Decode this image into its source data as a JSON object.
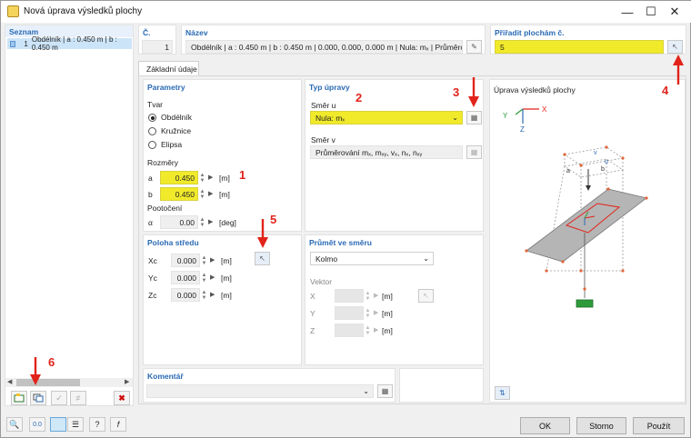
{
  "window": {
    "title": "Nová úprava výsledků plochy"
  },
  "list": {
    "header": "Seznam",
    "items": [
      {
        "number": "1",
        "text": "Obdélník | a : 0.450 m | b : 0.450 m"
      }
    ]
  },
  "header": {
    "number_label": "Č.",
    "number_value": "1",
    "name_label": "Název",
    "name_value": "Obdélník | a : 0.450 m | b : 0.450 m | 0.000, 0.000, 0.000 m | Nula: mₓ | Průměrování mₓ, mᵧ, vₓ, nₓ, nₓᵧ",
    "assign_label": "Přiřadit plochám č.",
    "assign_value": "5"
  },
  "tabs": [
    "Základní údaje"
  ],
  "parameters": {
    "header": "Parametry",
    "shape_label": "Tvar",
    "shapes": [
      "Obdélník",
      "Kružnice",
      "Elipsa"
    ],
    "selected_shape": "Obdélník",
    "dims_label": "Rozměry",
    "a_label": "a",
    "a_value": "0.450",
    "b_label": "b",
    "b_value": "0.450",
    "unit_m": "[m]",
    "rotation_label": "Pootočení",
    "alpha_label": "α",
    "alpha_value": "0.00",
    "unit_deg": "[deg]"
  },
  "type": {
    "header": "Typ úpravy",
    "u_label": "Směr u",
    "u_value": "Nula: mₓ",
    "v_label": "Směr v",
    "v_value": "Průměrování mₓ, mₓᵧ, vₓ, nₓ, nₓᵧ"
  },
  "center": {
    "header": "Poloha středu",
    "xc_label": "Xc",
    "xc_value": "0.000",
    "yc_label": "Yc",
    "yc_value": "0.000",
    "zc_label": "Zc",
    "zc_value": "0.000",
    "unit": "[m]"
  },
  "projection": {
    "header": "Průmět ve směru",
    "value": "Kolmo",
    "vector_label": "Vektor",
    "x_label": "X",
    "y_label": "Y",
    "z_label": "Z",
    "unit": "[m]"
  },
  "preview": {
    "header": "Úprava výsledků plochy",
    "axis_y": "Y",
    "axis_x": "X",
    "axis_z": "Z",
    "label_a": "a",
    "label_b": "b",
    "label_u": "u",
    "label_v": "v"
  },
  "comment": {
    "header": "Komentář"
  },
  "buttons": {
    "ok": "OK",
    "cancel": "Storno",
    "apply": "Použít"
  },
  "callouts": [
    "1",
    "2",
    "3",
    "4",
    "5",
    "6"
  ],
  "colors": {
    "highlight": "#f1ea2b",
    "header_blue": "#2a6ab5",
    "annotation_red": "#e2231a"
  }
}
